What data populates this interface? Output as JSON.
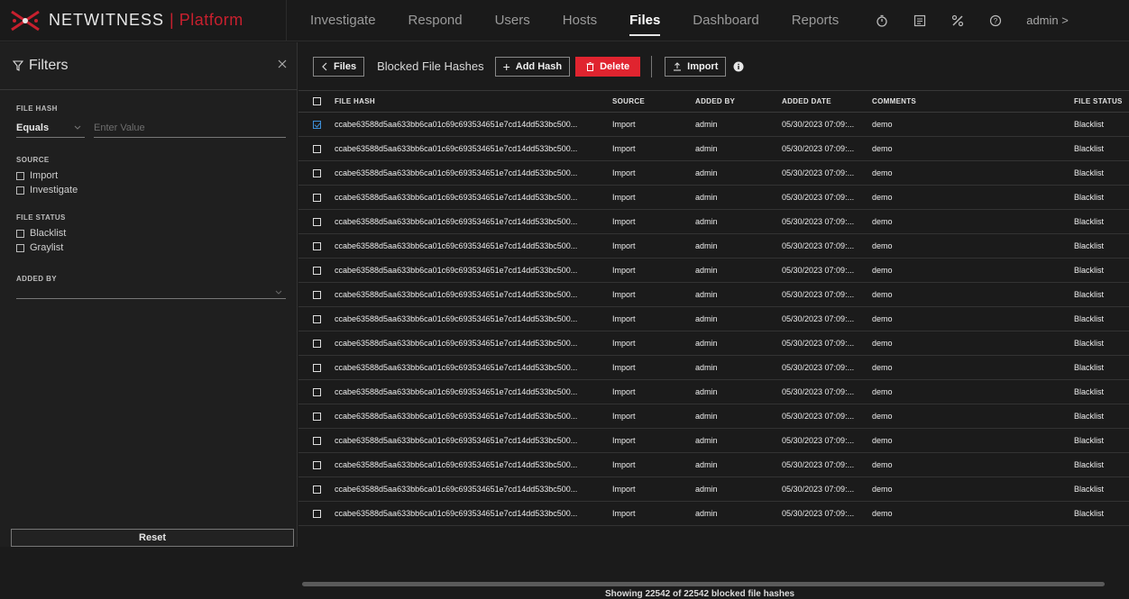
{
  "brand": {
    "name": "NETWITNESS",
    "separator": "|",
    "product": "Platform"
  },
  "nav": {
    "items": [
      {
        "label": "Investigate",
        "active": false
      },
      {
        "label": "Respond",
        "active": false
      },
      {
        "label": "Users",
        "active": false
      },
      {
        "label": "Hosts",
        "active": false
      },
      {
        "label": "Files",
        "active": true
      },
      {
        "label": "Dashboard",
        "active": false
      },
      {
        "label": "Reports",
        "active": false
      }
    ],
    "icons": [
      "timer-icon",
      "checklist-icon",
      "tools-icon",
      "help-icon"
    ],
    "user": "admin >"
  },
  "filters": {
    "title": "Filters",
    "file_hash": {
      "label": "FILE HASH",
      "operator": "Equals",
      "placeholder": "Enter Value"
    },
    "source": {
      "label": "SOURCE",
      "options": [
        "Import",
        "Investigate"
      ]
    },
    "file_status": {
      "label": "FILE STATUS",
      "options": [
        "Blacklist",
        "Graylist"
      ]
    },
    "added_by": {
      "label": "ADDED BY",
      "value": ""
    },
    "reset_label": "Reset"
  },
  "toolbar": {
    "back_label": "Files",
    "title": "Blocked File Hashes",
    "add_label": "Add Hash",
    "delete_label": "Delete",
    "import_label": "Import"
  },
  "table": {
    "headers": [
      "FILE HASH",
      "SOURCE",
      "ADDED BY",
      "ADDED DATE",
      "COMMENTS",
      "FILE STATUS"
    ],
    "rows": [
      {
        "checked": true,
        "hash": "ccabe63588d5aa633bb6ca01c69c693534651e7cd14dd533bc500...",
        "source": "Import",
        "added_by": "admin",
        "added_date": "05/30/2023 07:09:...",
        "comments": "demo",
        "status": "Blacklist"
      },
      {
        "checked": false,
        "hash": "ccabe63588d5aa633bb6ca01c69c693534651e7cd14dd533bc500...",
        "source": "Import",
        "added_by": "admin",
        "added_date": "05/30/2023 07:09:...",
        "comments": "demo",
        "status": "Blacklist"
      },
      {
        "checked": false,
        "hash": "ccabe63588d5aa633bb6ca01c69c693534651e7cd14dd533bc500...",
        "source": "Import",
        "added_by": "admin",
        "added_date": "05/30/2023 07:09:...",
        "comments": "demo",
        "status": "Blacklist"
      },
      {
        "checked": false,
        "hash": "ccabe63588d5aa633bb6ca01c69c693534651e7cd14dd533bc500...",
        "source": "Import",
        "added_by": "admin",
        "added_date": "05/30/2023 07:09:...",
        "comments": "demo",
        "status": "Blacklist"
      },
      {
        "checked": false,
        "hash": "ccabe63588d5aa633bb6ca01c69c693534651e7cd14dd533bc500...",
        "source": "Import",
        "added_by": "admin",
        "added_date": "05/30/2023 07:09:...",
        "comments": "demo",
        "status": "Blacklist"
      },
      {
        "checked": false,
        "hash": "ccabe63588d5aa633bb6ca01c69c693534651e7cd14dd533bc500...",
        "source": "Import",
        "added_by": "admin",
        "added_date": "05/30/2023 07:09:...",
        "comments": "demo",
        "status": "Blacklist"
      },
      {
        "checked": false,
        "hash": "ccabe63588d5aa633bb6ca01c69c693534651e7cd14dd533bc500...",
        "source": "Import",
        "added_by": "admin",
        "added_date": "05/30/2023 07:09:...",
        "comments": "demo",
        "status": "Blacklist"
      },
      {
        "checked": false,
        "hash": "ccabe63588d5aa633bb6ca01c69c693534651e7cd14dd533bc500...",
        "source": "Import",
        "added_by": "admin",
        "added_date": "05/30/2023 07:09:...",
        "comments": "demo",
        "status": "Blacklist"
      },
      {
        "checked": false,
        "hash": "ccabe63588d5aa633bb6ca01c69c693534651e7cd14dd533bc500...",
        "source": "Import",
        "added_by": "admin",
        "added_date": "05/30/2023 07:09:...",
        "comments": "demo",
        "status": "Blacklist"
      },
      {
        "checked": false,
        "hash": "ccabe63588d5aa633bb6ca01c69c693534651e7cd14dd533bc500...",
        "source": "Import",
        "added_by": "admin",
        "added_date": "05/30/2023 07:09:...",
        "comments": "demo",
        "status": "Blacklist"
      },
      {
        "checked": false,
        "hash": "ccabe63588d5aa633bb6ca01c69c693534651e7cd14dd533bc500...",
        "source": "Import",
        "added_by": "admin",
        "added_date": "05/30/2023 07:09:...",
        "comments": "demo",
        "status": "Blacklist"
      },
      {
        "checked": false,
        "hash": "ccabe63588d5aa633bb6ca01c69c693534651e7cd14dd533bc500...",
        "source": "Import",
        "added_by": "admin",
        "added_date": "05/30/2023 07:09:...",
        "comments": "demo",
        "status": "Blacklist"
      },
      {
        "checked": false,
        "hash": "ccabe63588d5aa633bb6ca01c69c693534651e7cd14dd533bc500...",
        "source": "Import",
        "added_by": "admin",
        "added_date": "05/30/2023 07:09:...",
        "comments": "demo",
        "status": "Blacklist"
      },
      {
        "checked": false,
        "hash": "ccabe63588d5aa633bb6ca01c69c693534651e7cd14dd533bc500...",
        "source": "Import",
        "added_by": "admin",
        "added_date": "05/30/2023 07:09:...",
        "comments": "demo",
        "status": "Blacklist"
      },
      {
        "checked": false,
        "hash": "ccabe63588d5aa633bb6ca01c69c693534651e7cd14dd533bc500...",
        "source": "Import",
        "added_by": "admin",
        "added_date": "05/30/2023 07:09:...",
        "comments": "demo",
        "status": "Blacklist"
      },
      {
        "checked": false,
        "hash": "ccabe63588d5aa633bb6ca01c69c693534651e7cd14dd533bc500...",
        "source": "Import",
        "added_by": "admin",
        "added_date": "05/30/2023 07:09:...",
        "comments": "demo",
        "status": "Blacklist"
      },
      {
        "checked": false,
        "hash": "ccabe63588d5aa633bb6ca01c69c693534651e7cd14dd533bc500...",
        "source": "Import",
        "added_by": "admin",
        "added_date": "05/30/2023 07:09:...",
        "comments": "demo",
        "status": "Blacklist"
      }
    ],
    "footer": "Showing 22542 of 22542 blocked file hashes"
  },
  "colors": {
    "accent_red": "#e0242f",
    "brand_red": "#c8202e",
    "checkbox_blue": "#3d8fd8"
  }
}
